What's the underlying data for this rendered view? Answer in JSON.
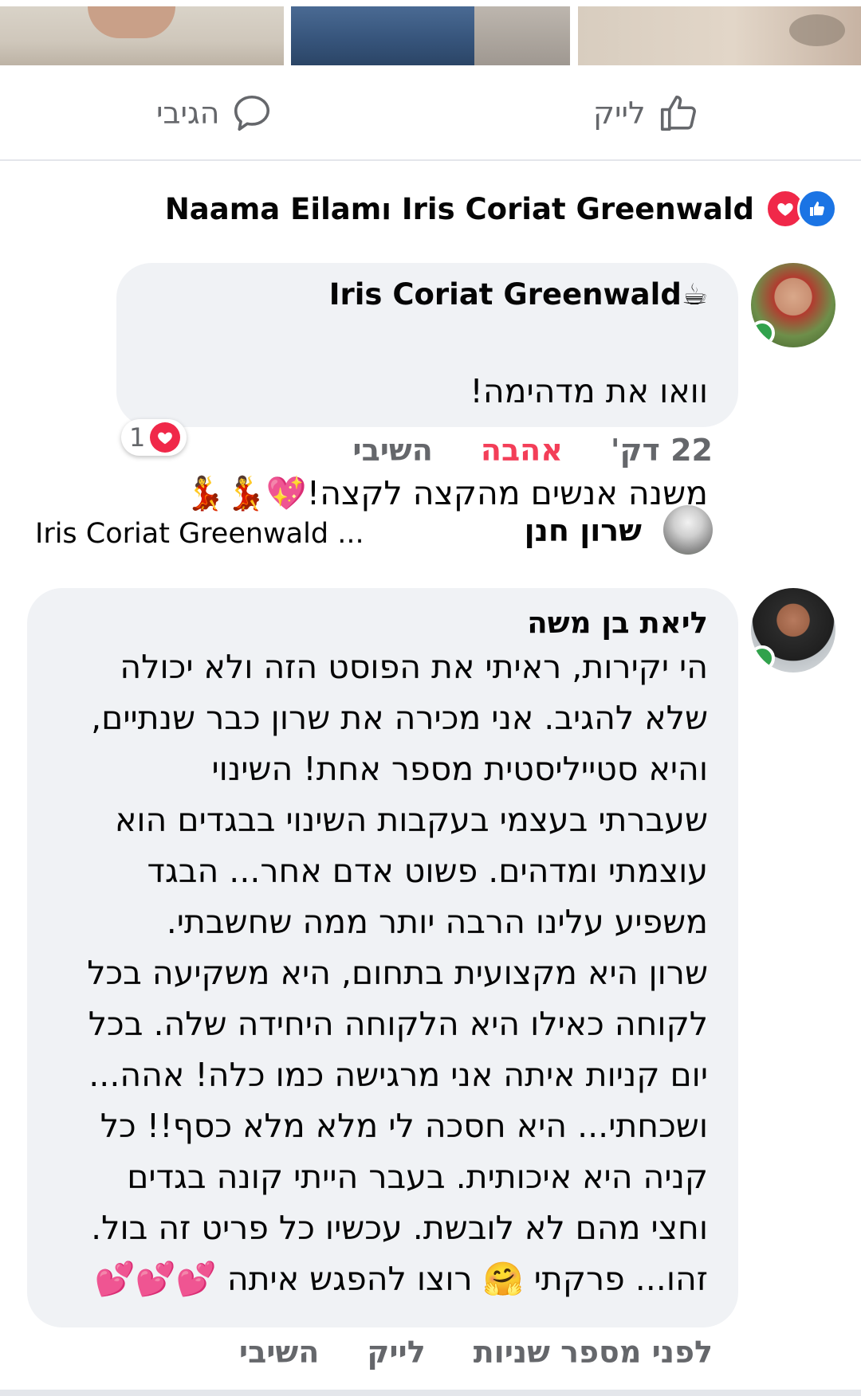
{
  "actions": {
    "like_label": "לייק",
    "reply_label": "הגיבי"
  },
  "reactors": {
    "names": "Iris Coriat Greenwald וNaama Eilam"
  },
  "comment1": {
    "author": "Iris Coriat Greenwald",
    "author_emoji": "☕",
    "lines": [
      "וואו את מדהימה!",
      "משנה אנשים מהקצה לקצה!"
    ],
    "emoji_suffix": "💖💃💃",
    "time": "22 דק'",
    "love_label": "אהבה",
    "reply_label": "השיבי",
    "reaction_count": "1"
  },
  "reply_preview": {
    "author": "שרון חנן",
    "text": "Iris Coriat Greenwald ..."
  },
  "comment2": {
    "author": "ליאת בן משה",
    "text": "הי יקירות, ראיתי את הפוסט הזה ולא יכולה\nשלא להגיב. אני מכירה את שרון כבר שנתיים,\nוהיא סטייליסטית מספר אחת! השינוי\nשעברתי בעצמי בעקבות השינוי בבגדים הוא\nעוצמתי ומדהים. פשוט אדם אחר... הבגד\nמשפיע עלינו הרבה יותר ממה שחשבתי.\nשרון היא מקצועית בתחום, היא משקיעה בכל\nלקוחה כאילו היא הלקוחה היחידה שלה. בכל\nיום קניות איתה אני מרגישה כמו כלה! אהה...\nושכחתי... היא חסכה לי מלא מלא כסף!! כל\nקניה היא איכותית. בעבר הייתי קונה בגדים\nוחצי מהם לא לובשת. עכשיו כל פריט זה בול.\nזהו... פרקתי 🤗 רוצו להפגש איתה 💕💕💕",
    "time": "לפני מספר שניות",
    "like_label": "לייק",
    "reply_label": "השיבי"
  }
}
